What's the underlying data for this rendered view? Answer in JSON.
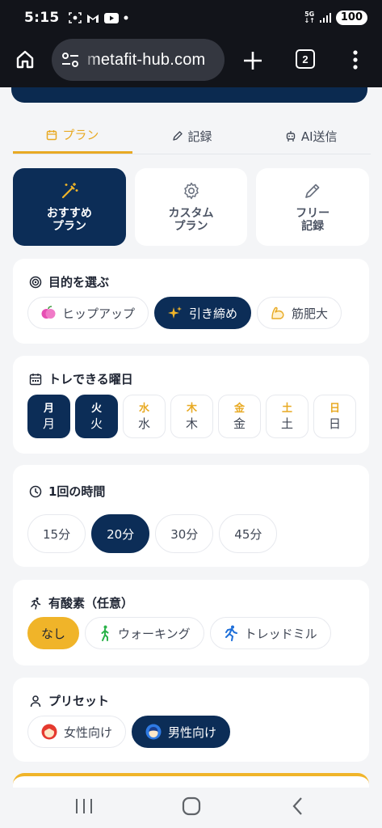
{
  "status_bar": {
    "time": "5:15",
    "network": "5G",
    "battery": "100"
  },
  "browser": {
    "url": "metafit-hub.com",
    "tab_count": "2"
  },
  "tabs": [
    {
      "label": "プラン",
      "icon": "calendar-icon",
      "active": true
    },
    {
      "label": "記録",
      "icon": "pencil-icon",
      "active": false
    },
    {
      "label": "AI送信",
      "icon": "robot-icon",
      "active": false
    }
  ],
  "modes": [
    {
      "label": "おすすめ\nプラン",
      "icon": "magic-wand-icon",
      "active": true
    },
    {
      "label": "カスタム\nプラン",
      "icon": "gear-icon",
      "active": false
    },
    {
      "label": "フリー\n記録",
      "icon": "pencil-icon",
      "active": false
    }
  ],
  "goal": {
    "title": "目的を選ぶ",
    "options": [
      {
        "label": "ヒップアップ",
        "icon": "peach-icon",
        "active": false
      },
      {
        "label": "引き締め",
        "icon": "sparkles-icon",
        "active": true
      },
      {
        "label": "筋肥大",
        "icon": "flexed-arm-icon",
        "active": false
      }
    ]
  },
  "days": {
    "title": "トレできる曜日",
    "items": [
      {
        "top": "月",
        "bottom": "月",
        "active": true
      },
      {
        "top": "火",
        "bottom": "火",
        "active": true
      },
      {
        "top": "水",
        "bottom": "水",
        "active": false
      },
      {
        "top": "木",
        "bottom": "木",
        "active": false
      },
      {
        "top": "金",
        "bottom": "金",
        "active": false
      },
      {
        "top": "土",
        "bottom": "土",
        "active": false
      },
      {
        "top": "日",
        "bottom": "日",
        "active": false
      }
    ]
  },
  "duration": {
    "title": "1回の時間",
    "options": [
      {
        "label": "15分",
        "active": false
      },
      {
        "label": "20分",
        "active": true
      },
      {
        "label": "30分",
        "active": false
      },
      {
        "label": "45分",
        "active": false
      }
    ]
  },
  "cardio": {
    "title": "有酸素（任意）",
    "options": [
      {
        "label": "なし",
        "icon": "",
        "active": true
      },
      {
        "label": "ウォーキング",
        "icon": "walking-person-icon",
        "active": false
      },
      {
        "label": "トレッドミル",
        "icon": "running-person-icon",
        "active": false
      }
    ]
  },
  "preset": {
    "title": "プリセット",
    "options": [
      {
        "label": "女性向け",
        "icon": "woman-face-icon",
        "active": false
      },
      {
        "label": "男性向け",
        "icon": "man-face-icon",
        "active": true
      }
    ]
  },
  "colors": {
    "navy": "#0c2d57",
    "accent": "#f0b429",
    "background": "#f4f5f7"
  }
}
